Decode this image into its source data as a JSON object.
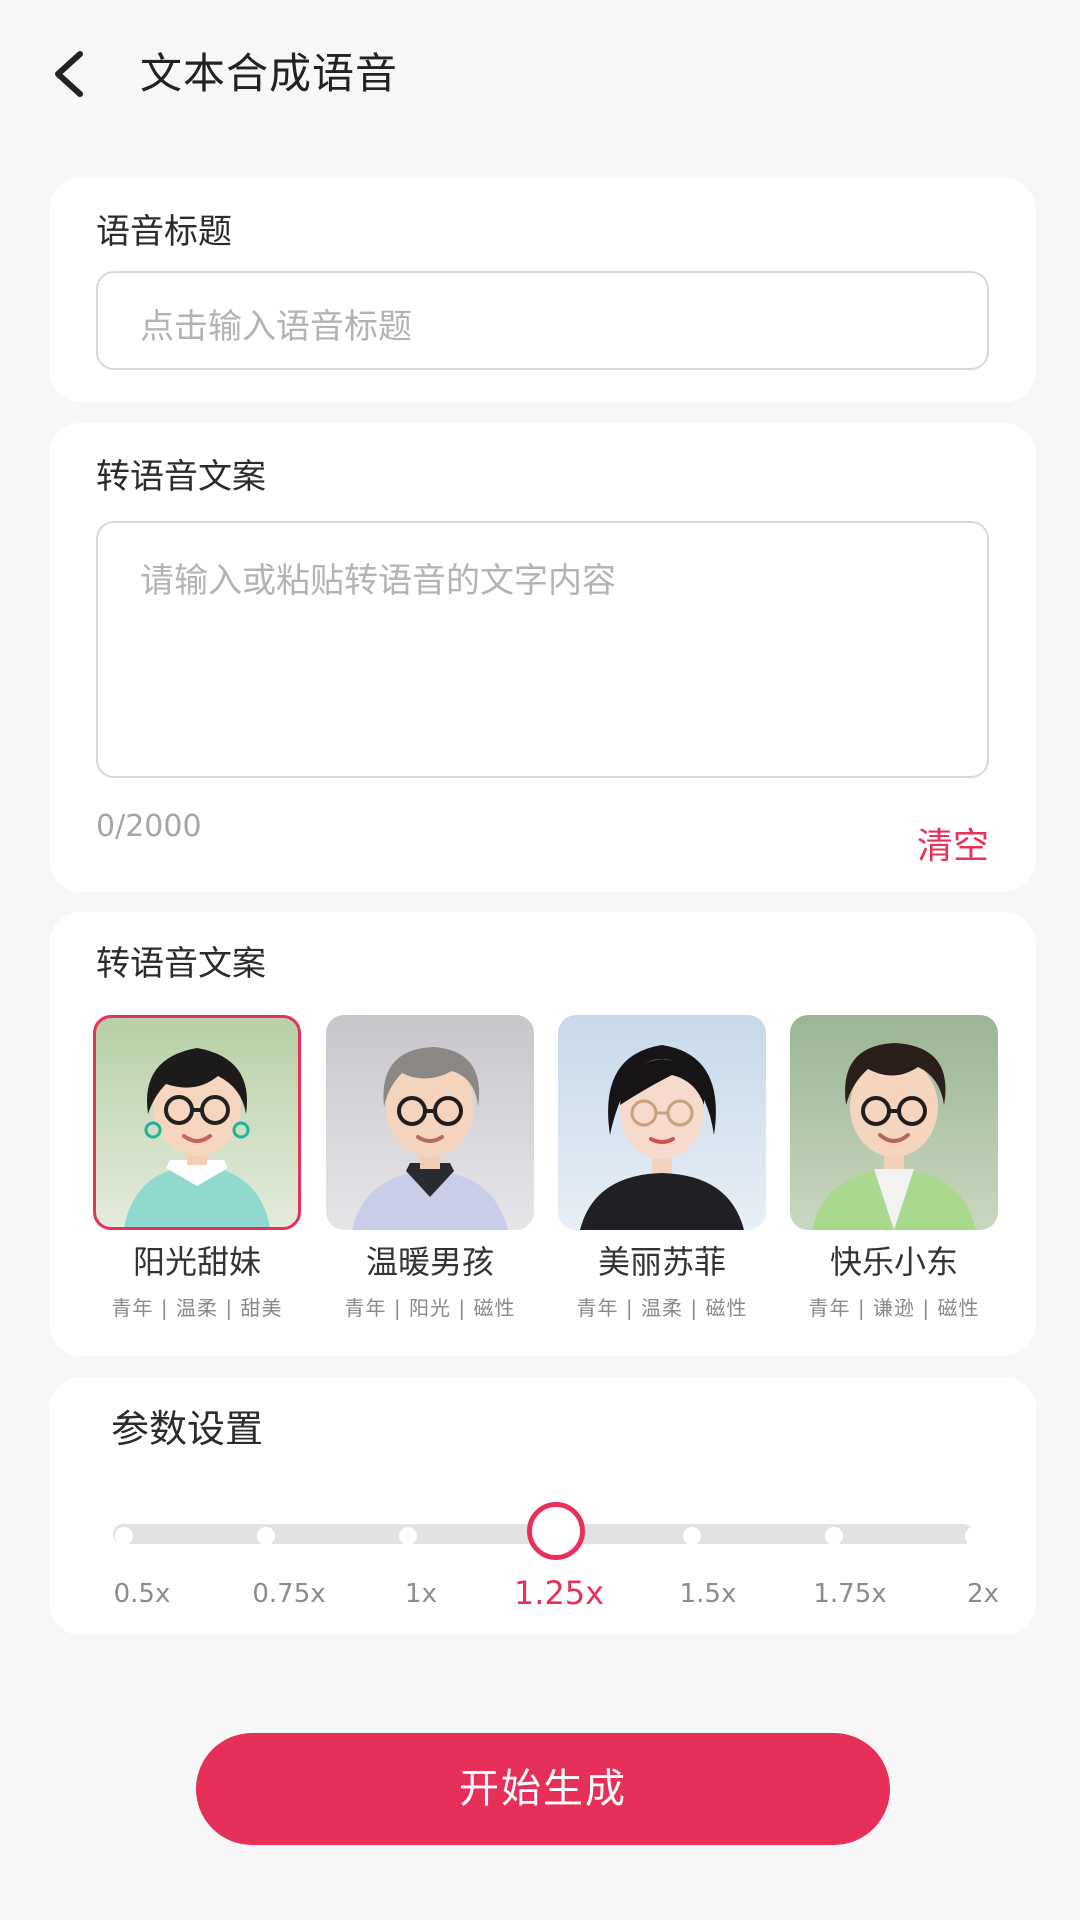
{
  "header": {
    "title": "文本合成语音"
  },
  "title_section": {
    "label": "语音标题",
    "placeholder": "点击输入语音标题"
  },
  "text_section": {
    "label": "转语音文案",
    "placeholder": "请输入或粘贴转语音的文字内容",
    "counter": "0/2000",
    "clear_label": "清空"
  },
  "voice_section": {
    "label": "转语音文案",
    "voices": [
      {
        "name": "阳光甜妹",
        "tags": "青年 | 温柔 | 甜美",
        "selected": true
      },
      {
        "name": "温暖男孩",
        "tags": "青年 | 阳光 | 磁性",
        "selected": false
      },
      {
        "name": "美丽苏菲",
        "tags": "青年 | 温柔 | 磁性",
        "selected": false
      },
      {
        "name": "快乐小东",
        "tags": "青年 | 谦逊 | 磁性",
        "selected": false
      }
    ]
  },
  "params_section": {
    "label": "参数设置",
    "speeds": [
      "0.5x",
      "0.75x",
      "1x",
      "1.25x",
      "1.5x",
      "1.75x",
      "2x"
    ],
    "selected_speed": "1.25x"
  },
  "actions": {
    "generate_label": "开始生成"
  },
  "colors": {
    "accent": "#e8315a",
    "background": "#f7f7f7"
  }
}
